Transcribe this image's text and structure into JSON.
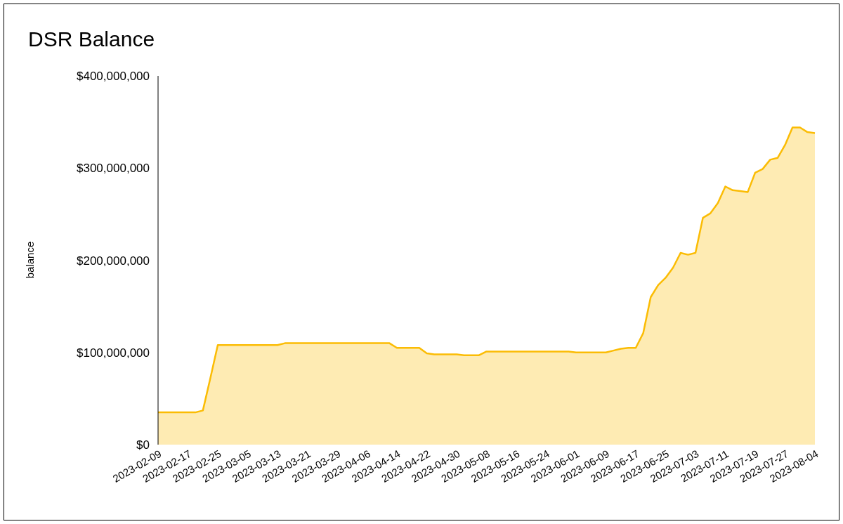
{
  "chart": {
    "title": "DSR Balance",
    "chart_data": {
      "type": "area",
      "ylabel": "balance",
      "categories": [
        "2023-02-09",
        null,
        null,
        null,
        "2023-02-17",
        null,
        null,
        null,
        "2023-02-25",
        null,
        null,
        null,
        "2023-03-05",
        null,
        null,
        null,
        "2023-03-13",
        null,
        null,
        null,
        "2023-03-21",
        null,
        null,
        null,
        "2023-03-29",
        null,
        null,
        null,
        "2023-04-06",
        null,
        null,
        null,
        "2023-04-14",
        null,
        null,
        null,
        "2023-04-22",
        null,
        null,
        null,
        "2023-04-30",
        null,
        null,
        null,
        "2023-05-08",
        null,
        null,
        null,
        "2023-05-16",
        null,
        null,
        null,
        "2023-05-24",
        null,
        null,
        null,
        "2023-06-01",
        null,
        null,
        null,
        "2023-06-09",
        null,
        null,
        null,
        "2023-06-17",
        null,
        null,
        null,
        "2023-06-25",
        null,
        null,
        null,
        "2023-07-03",
        null,
        null,
        null,
        "2023-07-11",
        null,
        null,
        null,
        "2023-07-19",
        null,
        null,
        null,
        "2023-07-27",
        null,
        null,
        null,
        "2023-08-04"
      ],
      "series": [
        {
          "color": "#fbbc04",
          "values": [
            35000000,
            35000000,
            35000000,
            35000000,
            35000000,
            35000000,
            37000000,
            72000000,
            108000000,
            108000000,
            108000000,
            108000000,
            108000000,
            108000000,
            108000000,
            108000000,
            108000000,
            110000000,
            110000000,
            110000000,
            110000000,
            110000000,
            110000000,
            110000000,
            110000000,
            110000000,
            110000000,
            110000000,
            110000000,
            110000000,
            110000000,
            110000000,
            105000000,
            105000000,
            105000000,
            105000000,
            99000000,
            98000000,
            98000000,
            98000000,
            98000000,
            97000000,
            97000000,
            97000000,
            101000000,
            101000000,
            101000000,
            101000000,
            101000000,
            101000000,
            101000000,
            101000000,
            101000000,
            101000000,
            101000000,
            101000000,
            100000000,
            100000000,
            100000000,
            100000000,
            100000000,
            102000000,
            104000000,
            105000000,
            105000000,
            121000000,
            160000000,
            173000000,
            181000000,
            192000000,
            208000000,
            206000000,
            208000000,
            246000000,
            251000000,
            262000000,
            280000000,
            276000000,
            275000000,
            274000000,
            295000000,
            299000000,
            309000000,
            311000000,
            325000000,
            344000000,
            344000000,
            339000000,
            338000000
          ]
        }
      ],
      "ylim": [
        0,
        400000000
      ],
      "yticks": [
        {
          "value": 0,
          "label": "$0"
        },
        {
          "value": 100000000,
          "label": "$100,000,000"
        },
        {
          "value": 200000000,
          "label": "$200,000,000"
        },
        {
          "value": 300000000,
          "label": "$300,000,000"
        },
        {
          "value": 400000000,
          "label": "$400,000,000"
        }
      ]
    }
  }
}
